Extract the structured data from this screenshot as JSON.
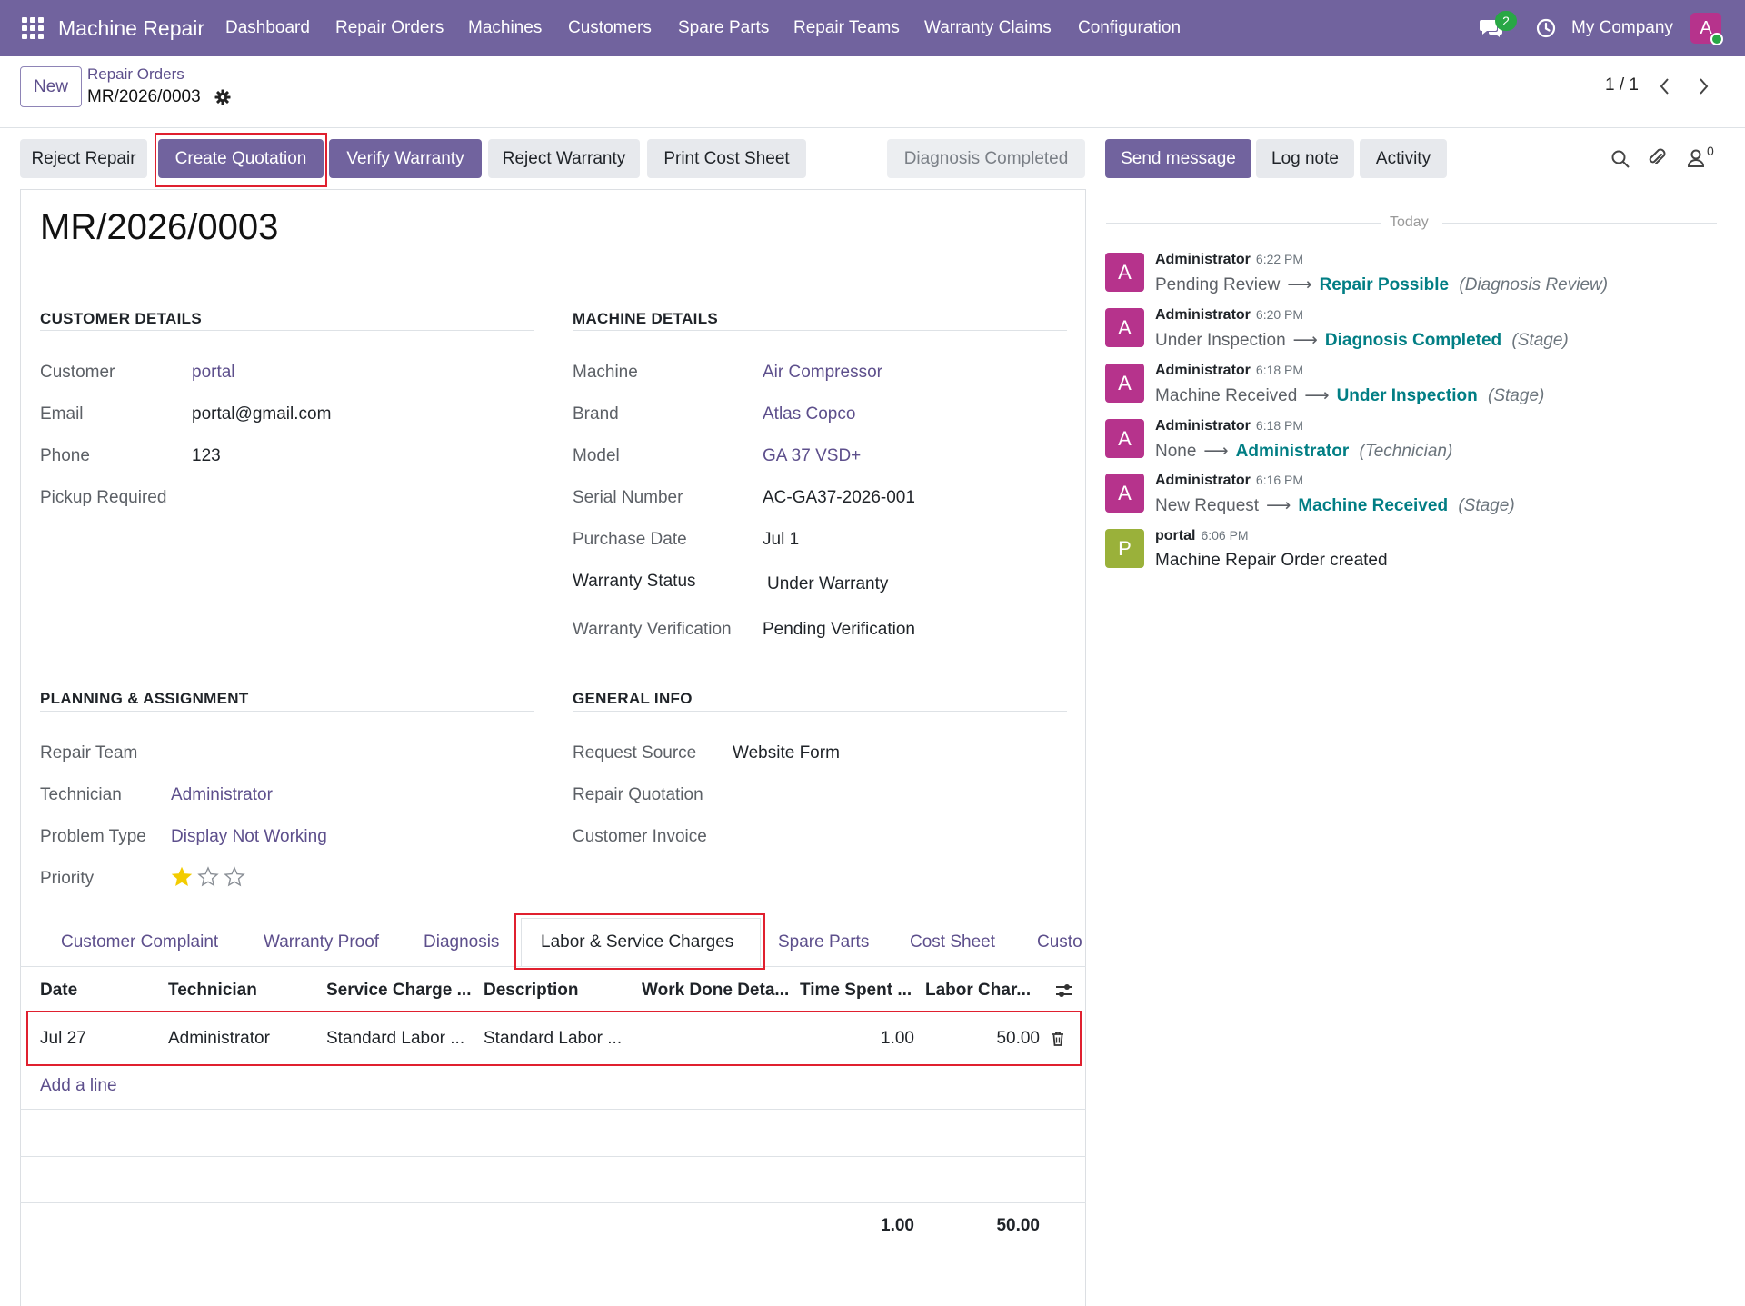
{
  "topnav": {
    "brand": "Machine Repair",
    "menu": [
      "Dashboard",
      "Repair Orders",
      "Machines",
      "Customers",
      "Spare Parts",
      "Repair Teams",
      "Warranty Claims",
      "Configuration"
    ],
    "chat_count": "2",
    "company": "My Company",
    "avatar_letter": "A"
  },
  "control": {
    "new_label": "New",
    "breadcrumb_parent": "Repair Orders",
    "breadcrumb_current": "MR/2026/0003",
    "pager": "1 / 1"
  },
  "actions": {
    "reject_repair": "Reject Repair",
    "create_quotation": "Create Quotation",
    "verify_warranty": "Verify Warranty",
    "reject_warranty": "Reject Warranty",
    "print_cost_sheet": "Print Cost Sheet",
    "stage": "Diagnosis Completed"
  },
  "chatter_actions": {
    "send_message": "Send message",
    "log_note": "Log note",
    "activity": "Activity",
    "followers_count": "0"
  },
  "record": {
    "title": "MR/2026/0003"
  },
  "customer_details": {
    "title": "CUSTOMER DETAILS",
    "customer_label": "Customer",
    "customer": "portal",
    "email_label": "Email",
    "email": "portal@gmail.com",
    "phone_label": "Phone",
    "phone": "123",
    "pickup_label": "Pickup Required"
  },
  "machine_details": {
    "title": "MACHINE DETAILS",
    "machine_label": "Machine",
    "machine": "Air Compressor",
    "brand_label": "Brand",
    "brand": "Atlas Copco",
    "model_label": "Model",
    "model": "GA 37 VSD+",
    "serial_label": "Serial Number",
    "serial": "AC-GA37-2026-001",
    "purchase_label": "Purchase Date",
    "purchase": "Jul 1",
    "warranty_status_label": "Warranty Status",
    "warranty_status": "Under Warranty",
    "warranty_verif_label": "Warranty Verification",
    "warranty_verif": "Pending Verification"
  },
  "planning": {
    "title": "PLANNING & ASSIGNMENT",
    "team_label": "Repair Team",
    "technician_label": "Technician",
    "technician": "Administrator",
    "problem_label": "Problem Type",
    "problem": "Display Not Working",
    "priority_label": "Priority",
    "priority_stars": 1,
    "priority_max": 3
  },
  "general_info": {
    "title": "GENERAL INFO",
    "source_label": "Request Source",
    "source": "Website Form",
    "quotation_label": "Repair Quotation",
    "invoice_label": "Customer Invoice"
  },
  "tabs": [
    "Customer Complaint",
    "Warranty Proof",
    "Diagnosis",
    "Labor & Service Charges",
    "Spare Parts",
    "Cost Sheet",
    "Custo"
  ],
  "table": {
    "headers": [
      "Date",
      "Technician",
      "Service Charge ...",
      "Description",
      "Work Done Deta...",
      "Time Spent ...",
      "Labor Char..."
    ],
    "rows": [
      [
        "Jul 27",
        "Administrator",
        "Standard Labor ...",
        "Standard Labor ...",
        "",
        "1.00",
        "50.00"
      ]
    ],
    "add_line": "Add a line",
    "total_time": "1.00",
    "total_labor": "50.00"
  },
  "chatter": {
    "today": "Today",
    "messages": [
      {
        "avatar": "A",
        "author": "Administrator",
        "time": "6:22 PM",
        "old": "Pending Review",
        "new": "Repair Possible",
        "field": "(Diagnosis Review)"
      },
      {
        "avatar": "A",
        "author": "Administrator",
        "time": "6:20 PM",
        "old": "Under Inspection",
        "new": "Diagnosis Completed",
        "field": "(Stage)"
      },
      {
        "avatar": "A",
        "author": "Administrator",
        "time": "6:18 PM",
        "old": "Machine Received",
        "new": "Under Inspection",
        "field": "(Stage)"
      },
      {
        "avatar": "A",
        "author": "Administrator",
        "time": "6:18 PM",
        "old": "None",
        "new": "Administrator",
        "field": "(Technician)"
      },
      {
        "avatar": "A",
        "author": "Administrator",
        "time": "6:16 PM",
        "old": "New Request",
        "new": "Machine Received",
        "field": "(Stage)"
      },
      {
        "avatar": "P",
        "author": "portal",
        "time": "6:06 PM",
        "text": "Machine Repair Order created"
      }
    ]
  },
  "colors": {
    "brand": "#71639e",
    "link": "#5d4f8c",
    "teal": "#017e84",
    "highlight": "#e0202f",
    "avatar_admin": "#b6338c",
    "avatar_portal": "#9ab13a"
  }
}
